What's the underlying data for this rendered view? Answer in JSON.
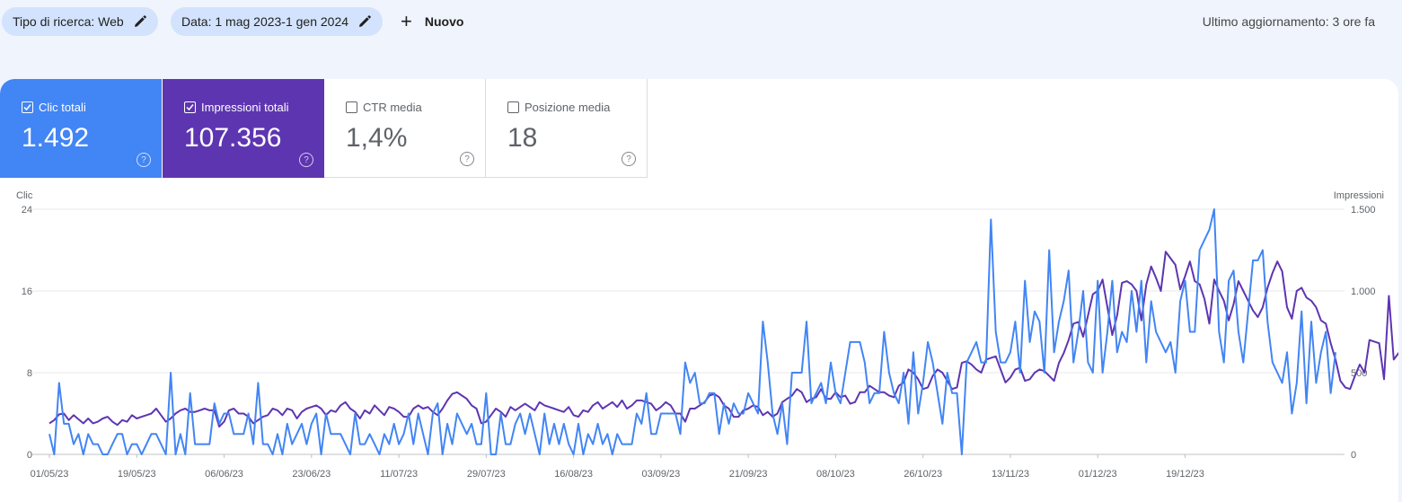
{
  "filters": {
    "search_type": "Tipo di ricerca: Web",
    "date": "Data: 1 mag 2023-1 gen 2024",
    "new_label": "Nuovo",
    "last_update": "Ultimo aggiornamento: 3 ore fa"
  },
  "metrics": [
    {
      "label": "Clic totali",
      "value": "1.492",
      "checked": true,
      "color": "#4285f4"
    },
    {
      "label": "Impressioni totali",
      "value": "107.356",
      "checked": true,
      "color": "#5e35b1"
    },
    {
      "label": "CTR media",
      "value": "1,4%",
      "checked": false
    },
    {
      "label": "Posizione media",
      "value": "18",
      "checked": false
    }
  ],
  "chart_data": {
    "type": "line",
    "y_left_label": "Clic",
    "y_right_label": "Impressioni",
    "y_left_ticks": [
      "0",
      "8",
      "16",
      "24"
    ],
    "y_right_ticks": [
      "0",
      "500",
      "1.000",
      "1.500"
    ],
    "y_left_range": [
      0,
      24
    ],
    "y_right_range": [
      0,
      1500
    ],
    "x_labels": [
      "01/05/23",
      "19/05/23",
      "06/06/23",
      "23/06/23",
      "11/07/23",
      "29/07/23",
      "16/08/23",
      "03/09/23",
      "21/09/23",
      "08/10/23",
      "26/10/23",
      "13/11/23",
      "01/12/23",
      "19/12/23"
    ],
    "grid": "horizontal",
    "series": [
      {
        "name": "Clic",
        "axis": "left",
        "color": "#4285f4",
        "values": [
          2,
          0,
          7,
          3,
          3,
          1,
          2,
          0,
          2,
          1,
          1,
          0,
          0,
          1,
          2,
          2,
          0,
          1,
          1,
          0,
          1,
          2,
          2,
          1,
          0,
          8,
          0,
          2,
          0,
          6,
          1,
          1,
          1,
          1,
          5,
          3,
          4,
          4,
          2,
          2,
          2,
          4,
          1,
          7,
          1,
          1,
          0,
          2,
          0,
          3,
          1,
          2,
          3,
          1,
          3,
          4,
          0,
          4,
          2,
          2,
          2,
          1,
          0,
          4,
          1,
          1,
          2,
          1,
          0,
          2,
          1,
          3,
          1,
          2,
          4,
          1,
          4,
          2,
          0,
          4,
          5,
          0,
          3,
          1,
          4,
          3,
          2,
          3,
          1,
          1,
          6,
          0,
          0,
          4,
          1,
          1,
          3,
          4,
          2,
          4,
          2,
          0,
          4,
          1,
          3,
          1,
          3,
          1,
          0,
          3,
          0,
          2,
          1,
          3,
          1,
          2,
          0,
          2,
          1,
          1,
          1,
          4,
          3,
          6,
          2,
          2,
          4,
          4,
          4,
          4,
          2,
          9,
          7,
          8,
          5,
          5,
          6,
          6,
          2,
          5,
          3,
          5,
          4,
          4,
          6,
          5,
          4,
          13,
          9,
          4,
          2,
          5,
          1,
          8,
          8,
          8,
          13,
          5,
          6,
          7,
          5,
          9,
          6,
          5,
          8,
          11,
          11,
          11,
          9,
          5,
          6,
          6,
          12,
          8,
          6,
          5,
          8,
          3,
          10,
          4,
          7,
          11,
          9,
          6,
          3,
          8,
          6,
          6,
          0,
          9,
          10,
          11,
          9,
          9,
          23,
          12,
          9,
          9,
          10,
          13,
          8,
          17,
          11,
          14,
          13,
          8,
          20,
          10,
          13,
          15,
          18,
          9,
          12,
          16,
          9,
          8,
          17,
          8,
          12,
          17,
          10,
          12,
          11,
          16,
          12,
          17,
          9,
          15,
          12,
          11,
          10,
          11,
          8,
          15,
          17,
          12,
          12,
          20,
          21,
          22,
          24,
          12,
          9,
          17,
          18,
          12,
          9,
          14,
          19,
          19,
          20,
          13,
          9,
          8,
          7,
          10,
          4,
          7,
          14,
          5,
          13,
          7,
          10,
          12,
          6,
          10
        ]
      },
      {
        "name": "Impressioni",
        "axis": "right",
        "color": "#5e35b1",
        "values": [
          190,
          210,
          245,
          250,
          210,
          240,
          215,
          190,
          220,
          190,
          200,
          220,
          230,
          200,
          180,
          210,
          200,
          240,
          220,
          230,
          240,
          250,
          280,
          240,
          200,
          220,
          250,
          270,
          280,
          260,
          260,
          270,
          280,
          270,
          270,
          170,
          200,
          270,
          280,
          250,
          250,
          230,
          190,
          210,
          230,
          240,
          280,
          270,
          240,
          280,
          270,
          220,
          260,
          280,
          290,
          300,
          280,
          240,
          270,
          260,
          300,
          320,
          280,
          260,
          220,
          270,
          250,
          300,
          270,
          240,
          290,
          280,
          260,
          230,
          230,
          280,
          300,
          280,
          290,
          260,
          240,
          280,
          330,
          370,
          380,
          360,
          340,
          300,
          280,
          190,
          200,
          240,
          280,
          260,
          230,
          290,
          270,
          290,
          310,
          290,
          270,
          320,
          300,
          290,
          280,
          270,
          260,
          290,
          240,
          230,
          270,
          260,
          300,
          320,
          280,
          300,
          320,
          290,
          330,
          280,
          300,
          330,
          330,
          320,
          310,
          270,
          290,
          320,
          300,
          250,
          250,
          200,
          280,
          280,
          300,
          320,
          360,
          370,
          350,
          300,
          280,
          230,
          230,
          270,
          280,
          300,
          290,
          240,
          260,
          230,
          250,
          320,
          340,
          360,
          400,
          380,
          320,
          340,
          350,
          400,
          340,
          340,
          380,
          350,
          360,
          310,
          320,
          380,
          380,
          420,
          400,
          380,
          380,
          360,
          350,
          420,
          440,
          520,
          500,
          460,
          400,
          410,
          480,
          520,
          500,
          450,
          400,
          410,
          560,
          570,
          550,
          520,
          500,
          580,
          590,
          600,
          520,
          440,
          470,
          520,
          530,
          450,
          460,
          500,
          520,
          510,
          480,
          450,
          560,
          620,
          700,
          800,
          810,
          720,
          850,
          980,
          1000,
          1070,
          900,
          730,
          850,
          1050,
          1060,
          1040,
          1000,
          820,
          1040,
          1150,
          1080,
          1000,
          1240,
          1200,
          1160,
          1010,
          1090,
          1180,
          1060,
          1040,
          950,
          800,
          1070,
          1000,
          940,
          820,
          920,
          1060,
          1000,
          940,
          880,
          840,
          900,
          1020,
          1110,
          1180,
          1120,
          900,
          830,
          1000,
          1020,
          960,
          940,
          900,
          820,
          800,
          680,
          580,
          450,
          410,
          400,
          480,
          550,
          500,
          700,
          690,
          680,
          460,
          970,
          580,
          620,
          550,
          560,
          540
        ]
      }
    ]
  }
}
